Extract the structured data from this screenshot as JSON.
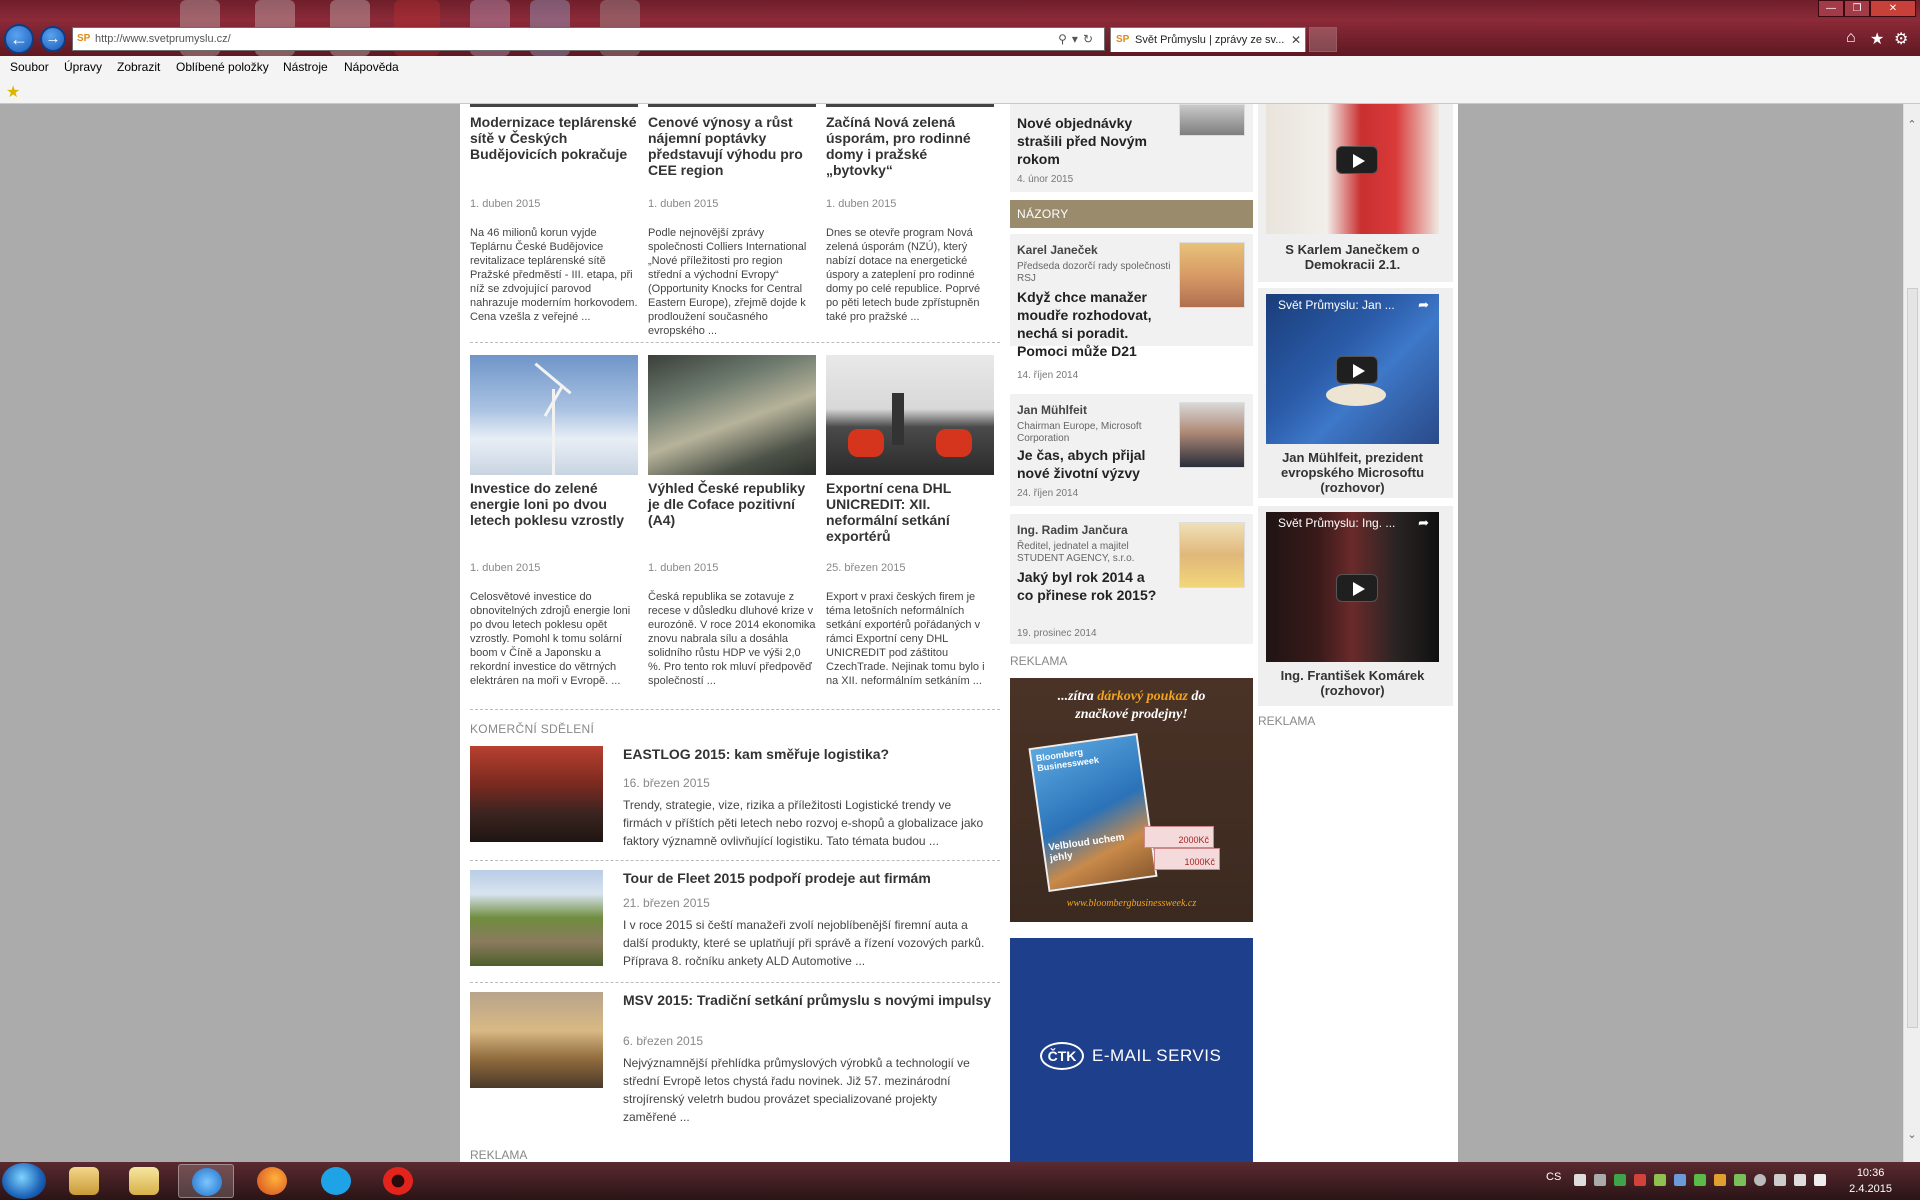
{
  "browser": {
    "address": "http://www.svetprumyslu.cz/",
    "favicon": "SP",
    "tab_title": "Svět Průmyslu | zprávy ze sv...",
    "tab_close": "✕"
  },
  "menu": [
    "Soubor",
    "Úpravy",
    "Zobrazit",
    "Oblíbené položky",
    "Nástroje",
    "Nápověda"
  ],
  "articles_top": [
    {
      "title": "Modernizace teplárenské sítě v Českých Budějovicích pokračuje",
      "date": "1. duben 2015",
      "text": "Na 46 milionů korun vyjde Teplárnu České Budějovice revitalizace teplárenské sítě Pražské předměstí - III. etapa, při níž se zdvojující parovod nahrazuje moderním horkovodem. Cena vzešla z veřejné ..."
    },
    {
      "title": "Cenové výnosy a růst nájemní poptávky představují výhodu pro CEE region",
      "date": "1. duben 2015",
      "text": "Podle nejnovější zprávy společnosti Colliers International „Nové příležitosti pro region střední a východní Evropy“ (Opportunity Knocks for Central Eastern Europe), zřejmě dojde k prodloužení současného evropského ..."
    },
    {
      "title": "Začíná Nová zelená úsporám, pro rodinné domy i pražské „bytovky“",
      "date": "1. duben 2015",
      "text": "Dnes se otevře program Nová zelená úsporám (NZÚ), který nabízí dotace na energetické úspory a zateplení pro rodinné domy po celé republice. Poprvé po pěti letech bude zpřístupněn také pro pražské ..."
    }
  ],
  "articles_mid": [
    {
      "title": "Investice do zelené energie loni po dvou letech poklesu vzrostly",
      "date": "1. duben 2015",
      "text": "Celosvětové investice do obnovitelných zdrojů energie loni po dvou letech poklesu opět vzrostly. Pomohl k tomu solární boom v Číně a Japonsku a rekordní investice do větrných elektráren na moři v Evropě. ..."
    },
    {
      "title": "Výhled České republiky je dle Coface pozitivní (A4)",
      "date": "1. duben 2015",
      "text": "Česká republika se zotavuje z recese v důsledku dluhové krize v eurozóně. V roce 2014 ekonomika znovu nabrala sílu a dosáhla solidního růstu HDP ve výši 2,0 %. Pro tento rok mluví předpověď společností ..."
    },
    {
      "title": "Exportní cena DHL UNICREDIT: XII. neformální setkání exportérů",
      "date": "25. březen 2015",
      "text": "Export v praxi českých firem je téma letošních neformálních setkání exportérů pořádaných v rámci Exportní ceny DHL UNICREDIT pod záštitou CzechTrade. Nejinak tomu bylo i na  XII. neformálním setkáním ..."
    }
  ],
  "komercni": {
    "heading": "KOMERČNÍ SDĚLENÍ",
    "items": [
      {
        "title": "EASTLOG 2015: kam směřuje logistika?",
        "date": "16. březen 2015",
        "text": "Trendy, strategie, vize, rizika a příležitosti Logistické trendy ve firmách v příštích pěti letech nebo rozvoj e-shopů a globalizace jako faktory významně ovlivňující logistiku. Tato témata budou ..."
      },
      {
        "title": "Tour de Fleet 2015 podpoří prodeje aut firmám",
        "date": "21. březen 2015",
        "text": "  I v roce 2015 si čeští manažeři zvolí nejoblíbenější firemní auta a další produkty, které se uplatňují při správě a řízení vozových parků. Příprava 8. ročníku ankety ALD Automotive ..."
      },
      {
        "title": "MSV 2015: Tradiční setkání průmyslu s novými impulsy",
        "date": "6. březen 2015",
        "text": "Nejvýznamnější přehlídka průmyslových výrobků a technologií ve střední Evropě letos chystá řadu novinek. Již 57. mezinárodní strojírenský veletrh budou provázet specializované projekty zaměřené ..."
      }
    ],
    "reklama": "REKLAMA"
  },
  "sidebar": {
    "top_item": {
      "title": "Nové objednávky strašili před Novým rokom",
      "date": "4. únor 2015"
    },
    "nazory_heading": "NÁZORY",
    "opinions": [
      {
        "name": "Karel Janeček",
        "role": "Předseda dozorčí rady společnosti RSJ",
        "title": "Když chce manažer moudře rozhodovat, nechá si poradit. Pomoci může D21",
        "date": "14. říjen 2014"
      },
      {
        "name": "Jan Mühlfeit",
        "role": "Chairman Europe, Microsoft Corporation",
        "title": "Je čas, abych přijal nové životní výzvy",
        "date": "24. říjen 2014"
      },
      {
        "name": "Ing. Radim Jančura",
        "role": "Ředitel, jednatel a majitel STUDENT AGENCY, s.r.o.",
        "title": "Jaký byl rok 2014 a co přinese rok 2015?",
        "date": "19. prosinec 2014"
      }
    ],
    "reklama": "REKLAMA",
    "ad1": {
      "line1": "...zítra ",
      "line1b": "dárkový poukaz",
      "line1c": " do",
      "line2": "značkové prodejny!",
      "mag": "Bloomberg Businessweek",
      "tag": "Velbloud uchem jehly",
      "v1": "2000Kč",
      "v2": "1000Kč",
      "url": "www.bloombergbusinessweek.cz"
    },
    "ad2": {
      "logo": "ČTK",
      "text": "E-MAIL SERVIS"
    }
  },
  "videos": {
    "items": [
      {
        "overlay": "",
        "caption": "S Karlem Janečkem o Demokracii 2.1."
      },
      {
        "overlay": "Svět Průmyslu: Jan ...",
        "caption": "Jan Mühlfeit, prezident evropského Microsoftu (rozhovor)"
      },
      {
        "overlay": "Svět Průmyslu: Ing. ...",
        "caption": "Ing. František Komárek (rozhovor)"
      }
    ],
    "reklama": "REKLAMA"
  },
  "tray": {
    "lang": "CS",
    "time": "10:36",
    "date": "2.4.2015"
  },
  "colors": {
    "nazory_header": "#9b8b6d",
    "titlebar": "#7a2430",
    "ad2_bg": "#1e3f8c"
  }
}
